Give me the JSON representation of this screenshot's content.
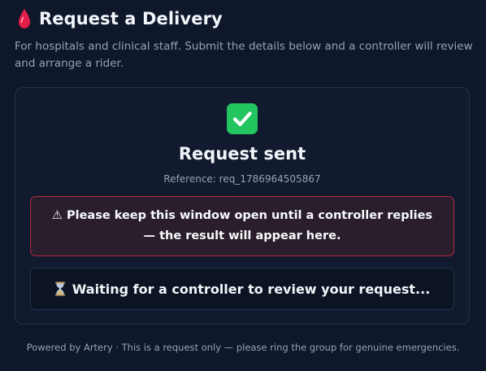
{
  "header": {
    "title": "Request a Delivery",
    "icon": "blood-drop-icon",
    "subtitle": "For hospitals and clinical staff. Submit the details below and a controller will review and arrange a rider."
  },
  "card": {
    "status_icon": "check-mark-icon",
    "title": "Request sent",
    "reference": "Reference: req_1786964505867",
    "warning": {
      "icon": "⚠",
      "text": "Please keep this window open until a controller replies — the result will appear here."
    },
    "status": {
      "icon": "hourglass-icon",
      "text": "Waiting for a controller to review your request..."
    }
  },
  "footer": {
    "text": "Powered by Artery · This is a request only — please ring the group for genuine emergencies."
  },
  "colors": {
    "background": "#0f172a",
    "card_background": "#111a2e",
    "accent_success": "#22c55e",
    "warning_border": "#b4283f",
    "drop_red": "#e11d48"
  }
}
